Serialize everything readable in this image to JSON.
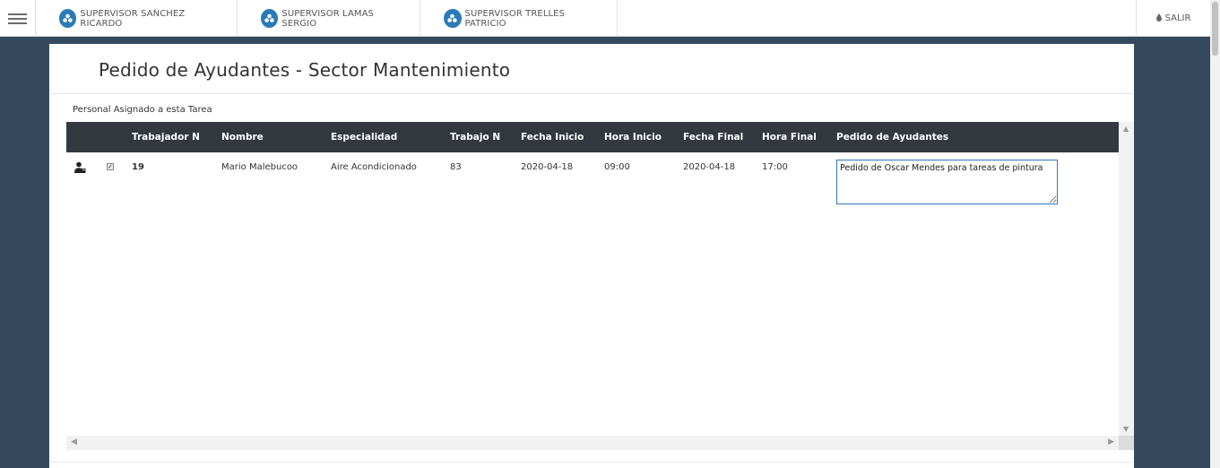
{
  "nav": {
    "tabs": [
      {
        "label": "SUPERVISOR SANCHEZ RICARDO",
        "icon": "supervisor-icon"
      },
      {
        "label": "SUPERVISOR LAMAS SERGIO",
        "icon": "supervisor-icon"
      },
      {
        "label": "SUPERVISOR TRELLES PATRICIO",
        "icon": "supervisor-icon"
      }
    ],
    "exit_label": "SALIR",
    "exit_icon": "drop-icon"
  },
  "page": {
    "title": "Pedido de Ayudantes - Sector Mantenimiento",
    "subtitle": "Personal Asignado a esta Tarea"
  },
  "table": {
    "columns": [
      "Trabajador N",
      "Nombre",
      "Especialidad",
      "Trabajo N",
      "Fecha Inicio",
      "Hora Inicio",
      "Fecha Final",
      "Hora Final",
      "Pedido de Ayudantes"
    ],
    "rows": [
      {
        "icon": "person-icon",
        "selected": true,
        "trabajador": "19",
        "nombre": "Mario Malebucoo",
        "especialidad": "Aire Acondicionado",
        "trabajo": "83",
        "fecha_inicio": "2020-04-18",
        "hora_inicio": "09:00",
        "fecha_final": "2020-04-18",
        "hora_final": "17:00",
        "pedido": "Pedido de Oscar Mendes para tareas de pintura"
      }
    ]
  },
  "colors": {
    "background": "#34495e",
    "header_row": "#34393f",
    "accent": "#2a7ab8"
  }
}
